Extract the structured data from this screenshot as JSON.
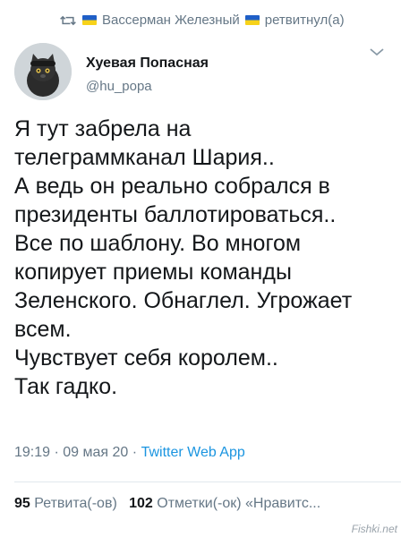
{
  "retweet": {
    "user": "Вассерман Железный",
    "action": "ретвитнул(а)"
  },
  "author": {
    "name": "Хуевая Попасная",
    "handle": "@hu_popa"
  },
  "tweet": {
    "lines": [
      "Я тут забрела на",
      "телеграммканал Шария..",
      "А ведь он реально собрался в",
      "президенты баллотироваться..",
      "Все по шаблону. Во многом",
      "копирует приемы команды",
      "Зеленского. Обнаглел. Угрожает",
      "всем.",
      "Чувствует себя королем..",
      "Так гадко."
    ],
    "time": "19:19",
    "date": "09 мая 20",
    "separator": "·",
    "source": "Twitter Web App"
  },
  "stats": {
    "retweets_count": "95",
    "retweets_label": "Ретвита(-ов)",
    "likes_count": "102",
    "likes_label": "Отметки(-ок) «Нравитс..."
  },
  "watermark": "Fishki.net",
  "colors": {
    "text": "#14171a",
    "secondary": "#657786",
    "link": "#1b95e0",
    "divider": "#e1e8ed"
  }
}
